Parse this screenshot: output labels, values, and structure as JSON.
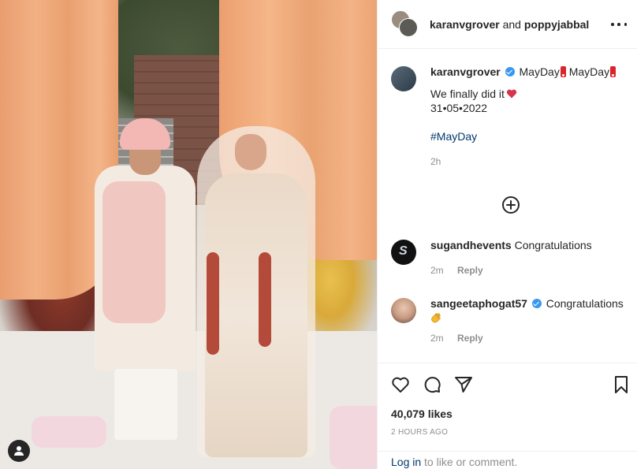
{
  "post": {
    "photo_alt": "Wedding photo of a couple under peach curtains",
    "header": {
      "username1": "karanvgrover",
      "connector": " and ",
      "username2": "poppyjabbal"
    },
    "caption": {
      "username": "karanvgrover",
      "text1": " MayDay",
      "text2": " MayDay",
      "line2": "We finally did it",
      "line3": "31•05•2022",
      "hashtag": "#MayDay",
      "time": "2h"
    },
    "comments": [
      {
        "username": "sugandhevents",
        "text": " Congratulations",
        "time": "2m",
        "reply_label": "Reply"
      },
      {
        "username": "sangeetaphogat57",
        "text": " Congratulations",
        "time": "2m",
        "reply_label": "Reply"
      }
    ],
    "likes": "40,079 likes",
    "timestamp": "2 HOURS AGO",
    "login": {
      "link": "Log in",
      "suffix": " to like or comment."
    }
  },
  "icons": {
    "more": "more-options-icon",
    "heart": "heart-icon",
    "comment": "comment-icon",
    "share": "share-icon",
    "save": "bookmark-icon",
    "load_more": "plus-circle-icon",
    "user_tag": "user-tag-icon",
    "verified": "verified-badge-icon"
  },
  "colors": {
    "link": "#00376b",
    "muted": "#8e8e8e",
    "verified": "#3897f0",
    "text": "#262626"
  }
}
